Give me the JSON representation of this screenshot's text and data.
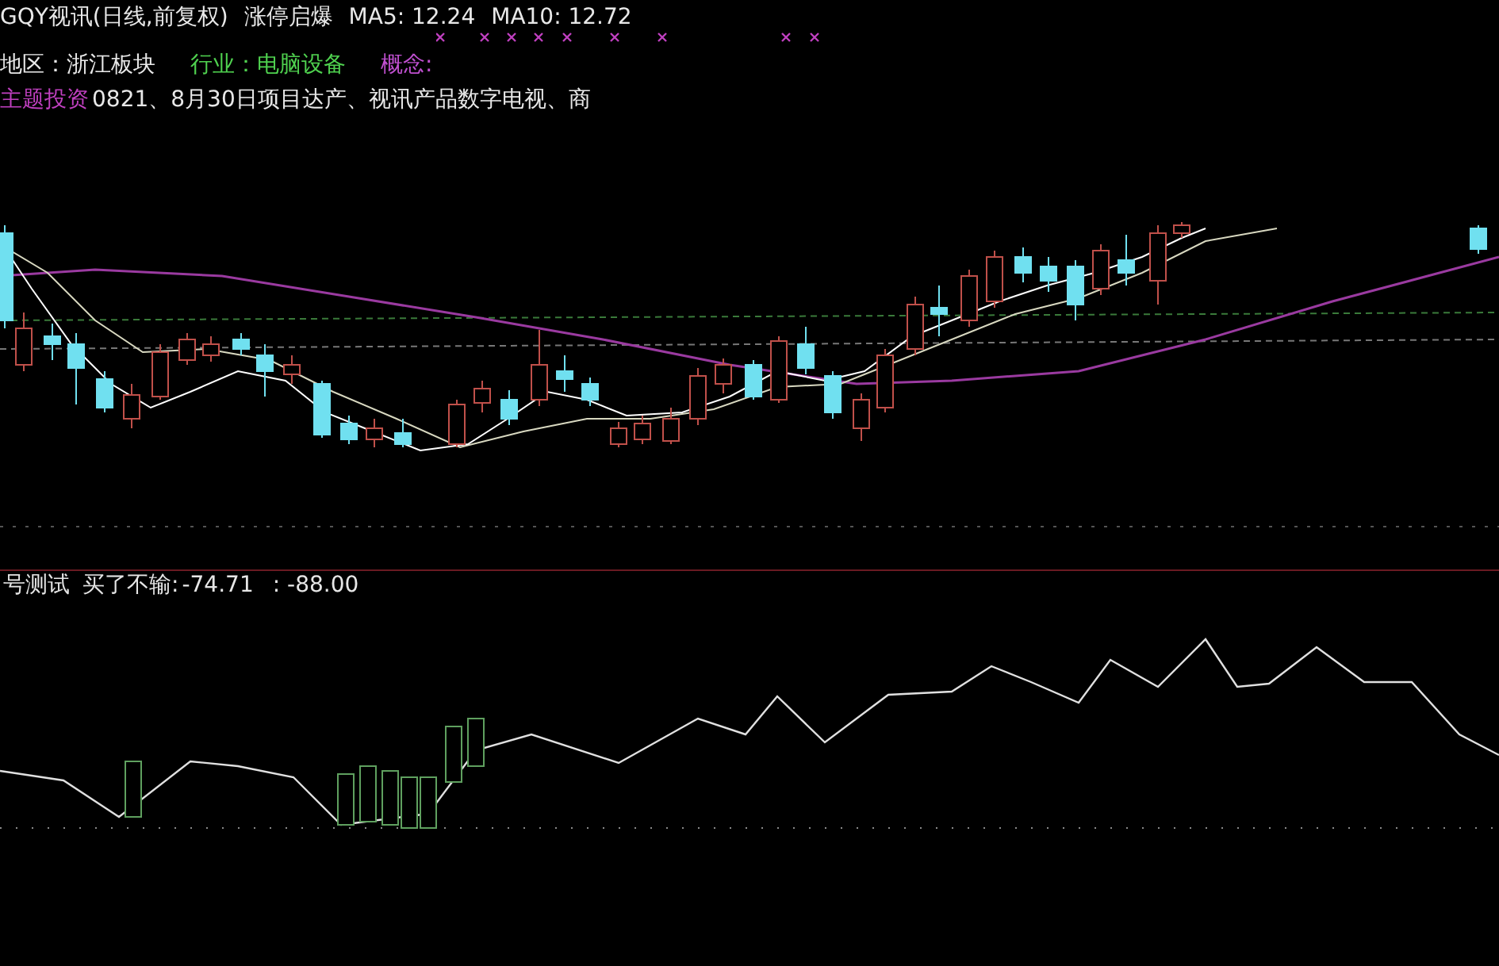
{
  "header": {
    "title": "GQY视讯(日线,前复权)",
    "pattern": "涨停启爆",
    "averages": [
      "MA5: 12.24",
      "MA10: 12.72"
    ]
  },
  "info": [
    {
      "kind": "region",
      "text": "地区：浙江板块"
    },
    {
      "kind": "industry",
      "text": "行业：电脑设备"
    },
    {
      "kind": "concept",
      "text": "概念:"
    }
  ],
  "theme": {
    "label": "主题投资",
    "text": "0821、8月30日项目达产、视讯产品数字电视、商"
  },
  "indicator": {
    "name": "号测试",
    "label": "买了不输:",
    "values": [
      "-74.71",
      ": -88.00"
    ]
  }
}
